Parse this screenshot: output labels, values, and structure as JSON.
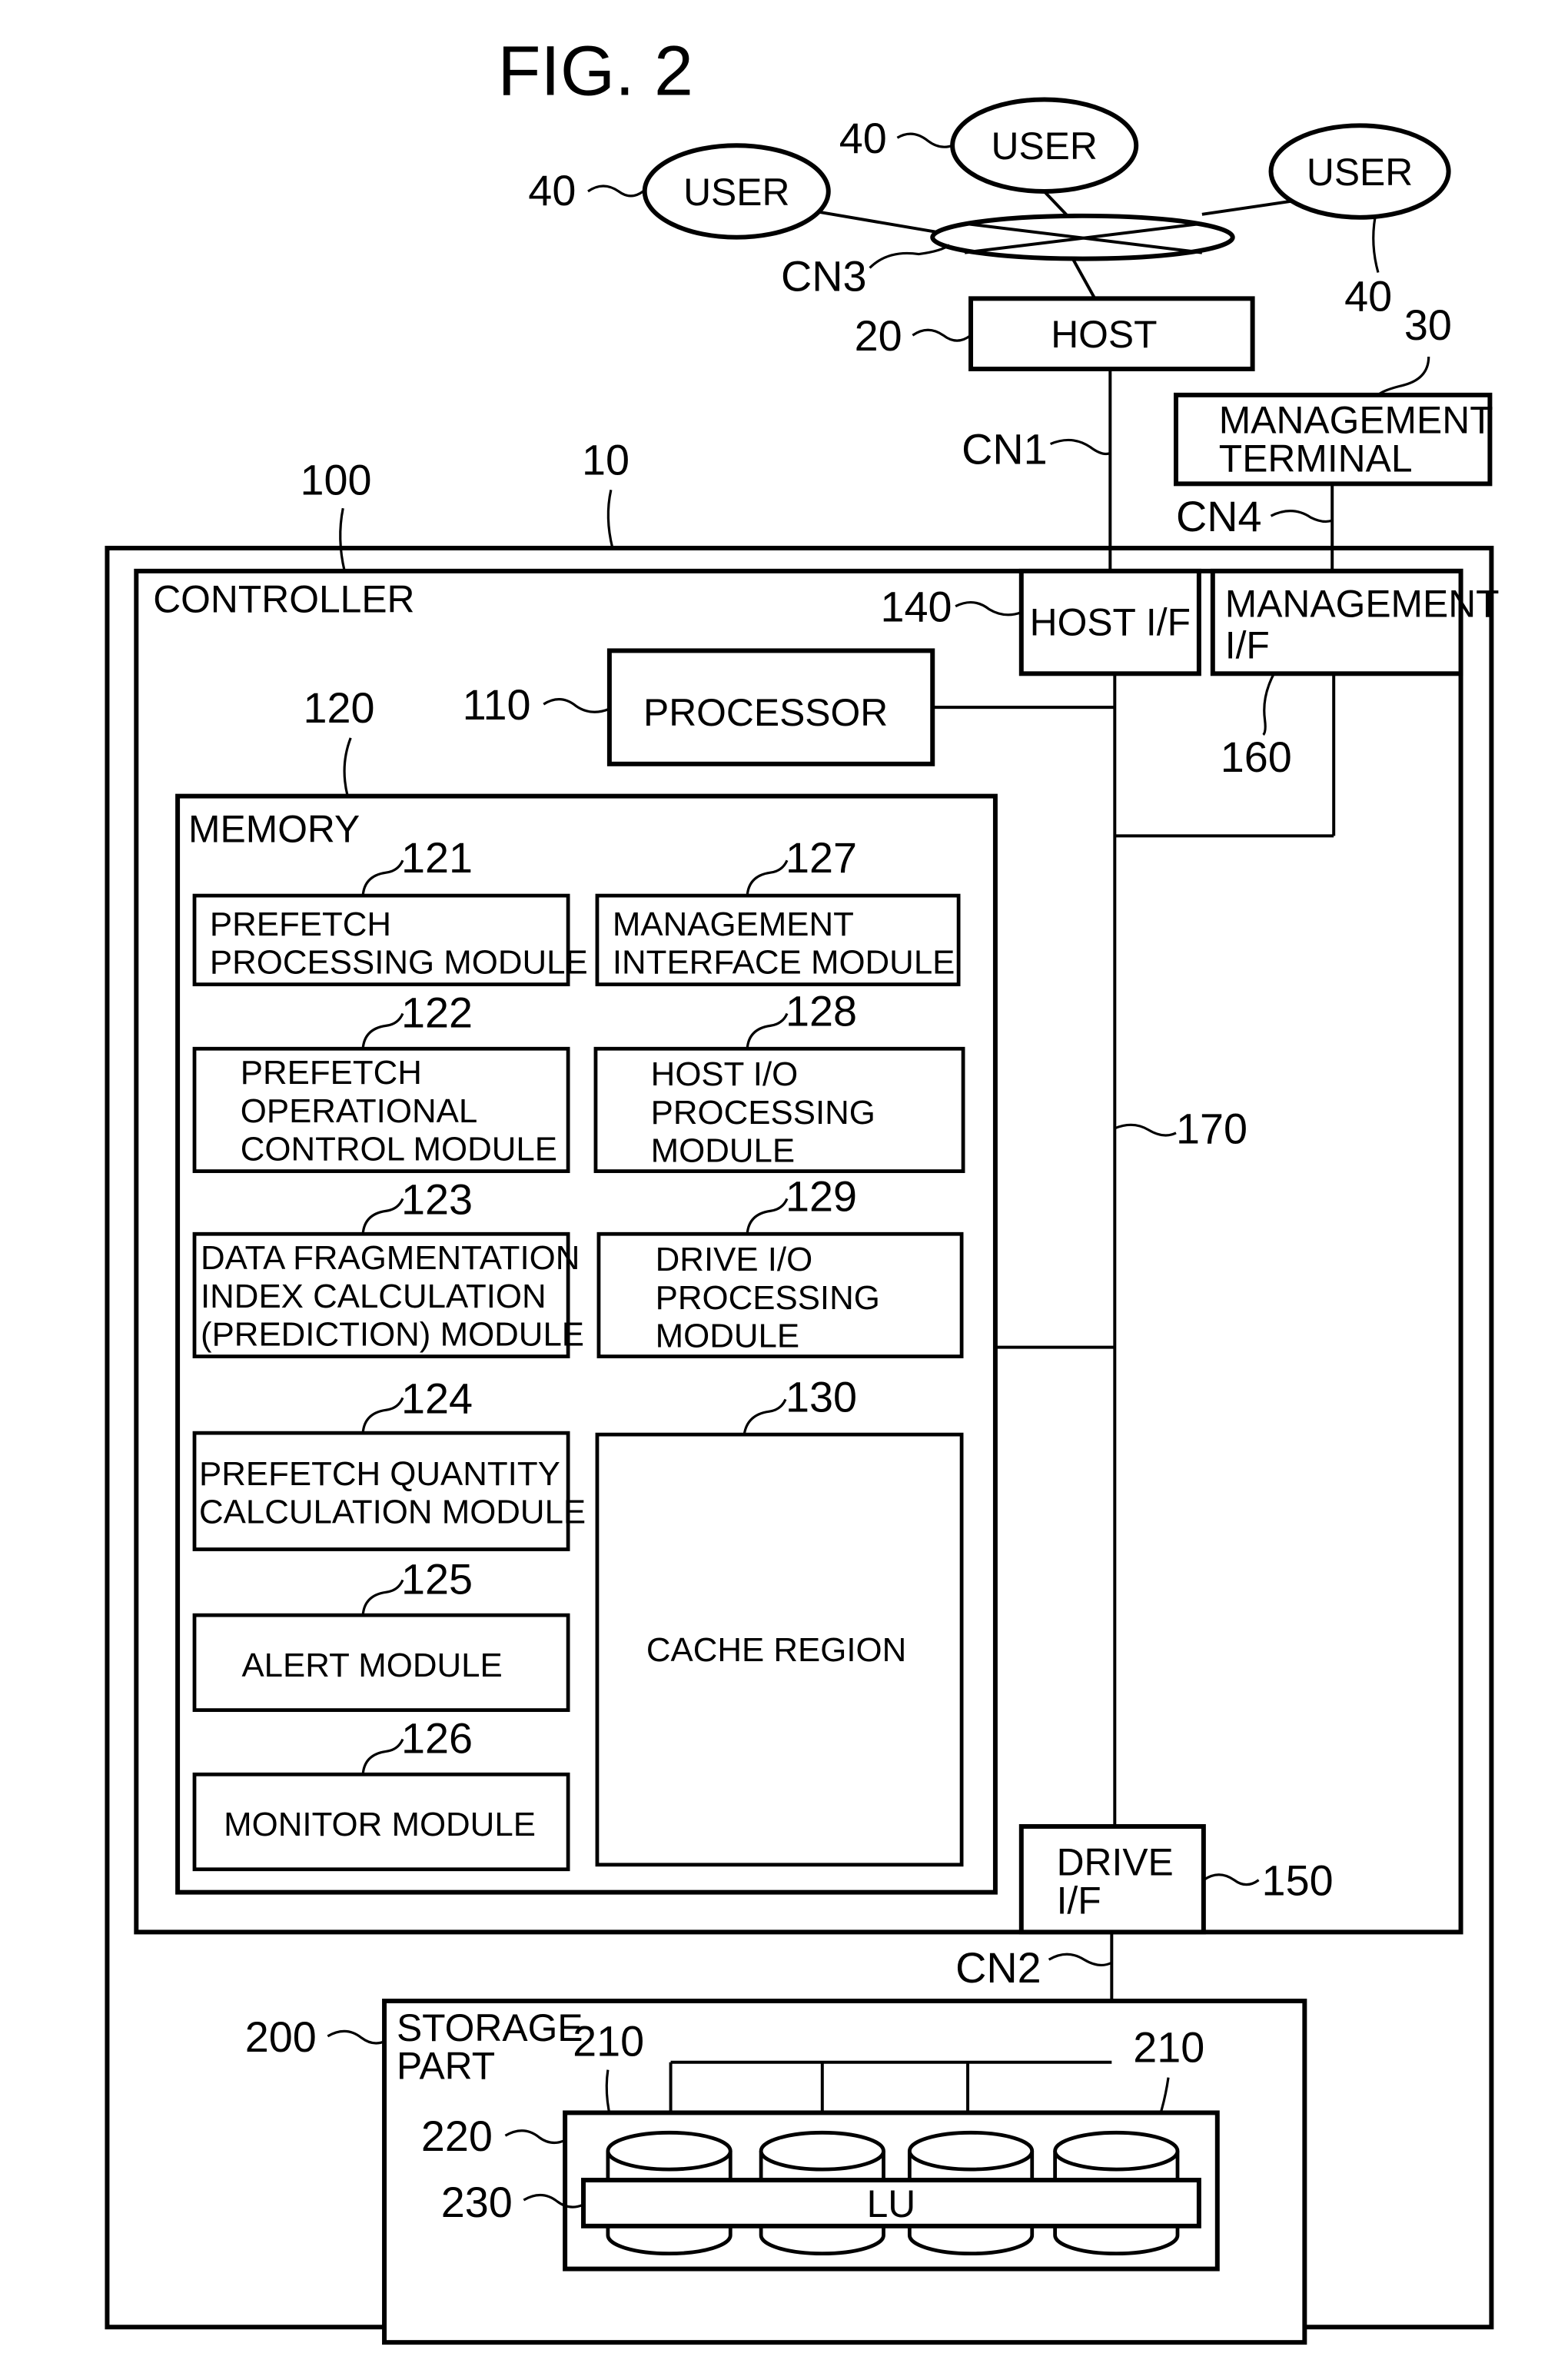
{
  "figure": {
    "title": "FIG. 2"
  },
  "users": [
    {
      "label": "USER",
      "ref": "40"
    },
    {
      "label": "USER",
      "ref": "40"
    },
    {
      "label": "USER",
      "ref": "40"
    }
  ],
  "network_user": {
    "ref": "CN3"
  },
  "host": {
    "label": "HOST",
    "ref": "20"
  },
  "management_terminal": {
    "lines": [
      "MANAGEMENT",
      "TERMINAL"
    ],
    "ref": "30"
  },
  "connections": {
    "host_link": "CN1",
    "mgmt_link": "CN4",
    "drive_link": "CN2"
  },
  "storage_system": {
    "ref": "10"
  },
  "controller": {
    "label": "CONTROLLER",
    "ref": "100",
    "host_if": {
      "label": "HOST I/F",
      "ref": "140"
    },
    "management_if": {
      "lines": [
        "MANAGEMENT",
        "I/F"
      ],
      "ref": "160"
    },
    "processor": {
      "label": "PROCESSOR",
      "ref": "110"
    },
    "bus": {
      "ref": "170"
    },
    "drive_if": {
      "lines": [
        "DRIVE",
        "I/F"
      ],
      "ref": "150"
    },
    "memory": {
      "label": "MEMORY",
      "ref": "120",
      "modules": [
        {
          "ref": "121",
          "lines": [
            "PREFETCH",
            "PROCESSING MODULE"
          ]
        },
        {
          "ref": "122",
          "lines": [
            "PREFETCH",
            "OPERATIONAL",
            "CONTROL MODULE"
          ]
        },
        {
          "ref": "123",
          "lines": [
            "DATA FRAGMENTATION",
            "INDEX CALCULATION",
            "(PREDICTION) MODULE"
          ]
        },
        {
          "ref": "124",
          "lines": [
            "PREFETCH QUANTITY",
            "CALCULATION MODULE"
          ]
        },
        {
          "ref": "125",
          "lines": [
            "ALERT MODULE"
          ]
        },
        {
          "ref": "126",
          "lines": [
            "MONITOR MODULE"
          ]
        },
        {
          "ref": "127",
          "lines": [
            "MANAGEMENT",
            "INTERFACE MODULE"
          ]
        },
        {
          "ref": "128",
          "lines": [
            "HOST I/O",
            "PROCESSING",
            "MODULE"
          ]
        },
        {
          "ref": "129",
          "lines": [
            "DRIVE I/O",
            "PROCESSING",
            "MODULE"
          ]
        }
      ],
      "cache": {
        "label": "CACHE REGION",
        "ref": "130"
      }
    }
  },
  "storage_part": {
    "lines": [
      "STORAGE",
      "PART"
    ],
    "ref": "200",
    "drive_ref_left": "210",
    "drive_ref_right": "210",
    "raid_group_ref": "220",
    "lu": {
      "label": "LU",
      "ref": "230"
    }
  }
}
